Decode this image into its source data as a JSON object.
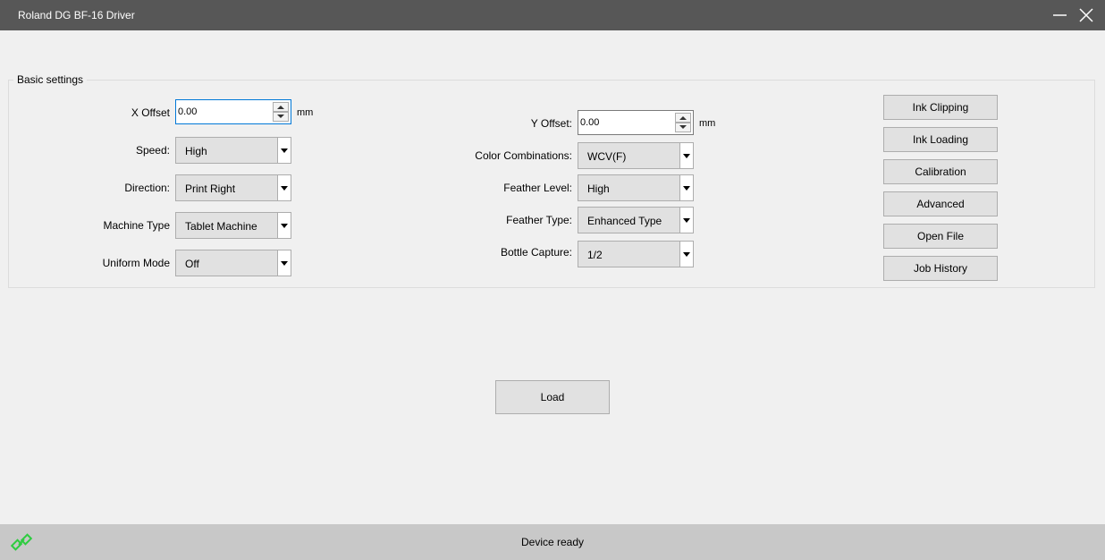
{
  "window": {
    "title": "Roland DG BF-16 Driver"
  },
  "group": {
    "title": "Basic settings"
  },
  "left": {
    "x_offset": {
      "label": "X Offset",
      "value": "0.00",
      "unit": "mm"
    },
    "speed": {
      "label": "Speed:",
      "value": "High"
    },
    "direction": {
      "label": "Direction:",
      "value": "Print Right"
    },
    "machine_type": {
      "label": "Machine Type",
      "value": "Tablet Machine"
    },
    "uniform_mode": {
      "label": "Uniform Mode",
      "value": "Off"
    }
  },
  "middle": {
    "y_offset": {
      "label": "Y Offset:",
      "value": "0.00",
      "unit": "mm"
    },
    "color_combinations": {
      "label": "Color Combinations:",
      "value": "WCV(F)"
    },
    "feather_level": {
      "label": "Feather Level:",
      "value": "High"
    },
    "feather_type": {
      "label": "Feather Type:",
      "value": "Enhanced Type"
    },
    "bottle_capture": {
      "label": "Bottle Capture:",
      "value": "1/2"
    }
  },
  "buttons": {
    "ink_clipping": "Ink Clipping",
    "ink_loading": "Ink Loading",
    "calibration": "Calibration",
    "advanced": "Advanced",
    "open_file": "Open File",
    "job_history": "Job History"
  },
  "load_button": "Load",
  "status": {
    "text": "Device ready",
    "icon": "link-icon",
    "icon_color": "#2ecc40"
  }
}
